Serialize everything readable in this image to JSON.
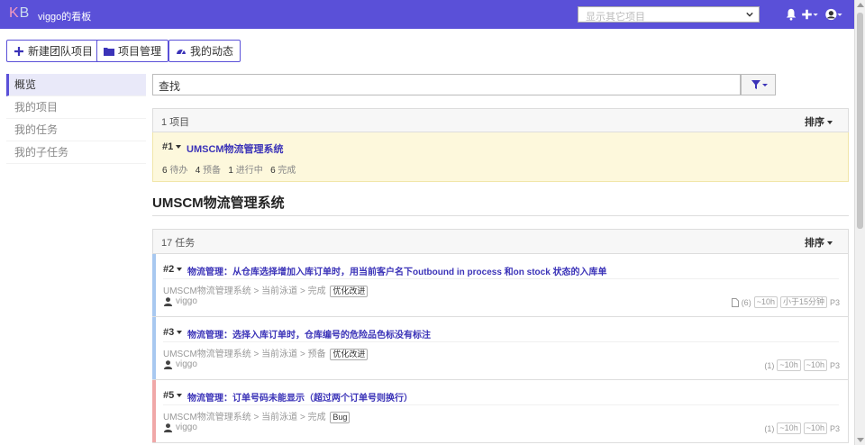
{
  "topbar": {
    "logo_k": "K",
    "logo_b": "B",
    "title": "viggo的看板",
    "project_select_placeholder": "显示其它项目",
    "icons": [
      "bell-icon",
      "plus-icon",
      "user-avatar-icon"
    ]
  },
  "actions": {
    "new_team_project": "新建团队项目",
    "project_management": "项目管理",
    "my_activity": "我的动态"
  },
  "sidebar": {
    "items": [
      {
        "label": "概览",
        "active": true
      },
      {
        "label": "我的项目",
        "active": false
      },
      {
        "label": "我的任务",
        "active": false
      },
      {
        "label": "我的子任务",
        "active": false
      }
    ]
  },
  "search": {
    "value": "查找"
  },
  "projects_panel": {
    "count": "1 项目",
    "sort_label": "排序",
    "project": {
      "id": "#1",
      "name": "UMSCM物流管理系统",
      "stats": [
        {
          "num": "6",
          "label": "待办"
        },
        {
          "num": "4",
          "label": "预备"
        },
        {
          "num": "1",
          "label": "进行中"
        },
        {
          "num": "6",
          "label": "完成"
        }
      ]
    }
  },
  "section_title": "UMSCM物流管理系统",
  "tasks_panel": {
    "count": "17 任务",
    "sort_label": "排序",
    "tasks": [
      {
        "id": "#2",
        "title": "物流管理：从仓库选择增加入库订单时，用当前客户名下outbound in process 和on stock 状态的入库单",
        "path": "UMSCM物流管理系统 > 当前泳道 > 完成",
        "tag": "优化改进",
        "user": "viggo",
        "color": "#a8c8f0",
        "comments": "(6)",
        "time_estimated": "~10h",
        "time_spent": "小于15分钟",
        "priority": "P3"
      },
      {
        "id": "#3",
        "title": "物流管理：选择入库订单时，仓库编号的危险品色标没有标注",
        "path": "UMSCM物流管理系统 > 当前泳道 > 预备",
        "tag": "优化改进",
        "user": "viggo",
        "color": "#a8c8f0",
        "comments": "(1)",
        "time_estimated": "~10h",
        "time_spent": "~10h",
        "priority": "P3"
      },
      {
        "id": "#5",
        "title": "物流管理：订单号码未能显示（超过两个订单号则换行）",
        "path": "UMSCM物流管理系统 > 当前泳道 > 完成",
        "tag": "Bug",
        "user": "viggo",
        "color": "#f0a8a8",
        "comments": "(1)",
        "time_estimated": "~10h",
        "time_spent": "~10h",
        "priority": "P3"
      }
    ]
  }
}
